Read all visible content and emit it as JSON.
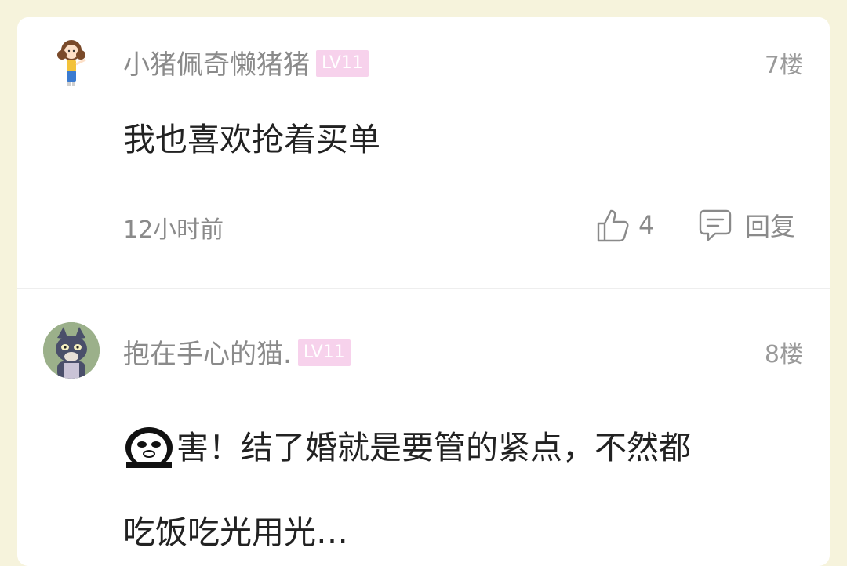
{
  "comments": [
    {
      "username": "小猪佩奇懒猪猪",
      "level": "LV11",
      "floor": "7楼",
      "text": "我也喜欢抢着买单",
      "time": "12小时前",
      "likes": "4",
      "reply_label": "回复"
    },
    {
      "username": "抱在手心的猫.",
      "level": "LV11",
      "floor": "8楼",
      "text_line1": "害！结了婚就是要管的紧点，不然都",
      "text_line2": "吃饭吃光用光…"
    }
  ],
  "colors": {
    "background": "#f6f3dc",
    "level_badge": "#f7d2ec",
    "muted_text": "#8a8a8a"
  },
  "icons": [
    "like-icon",
    "comment-icon",
    "panda-sticker-icon"
  ]
}
